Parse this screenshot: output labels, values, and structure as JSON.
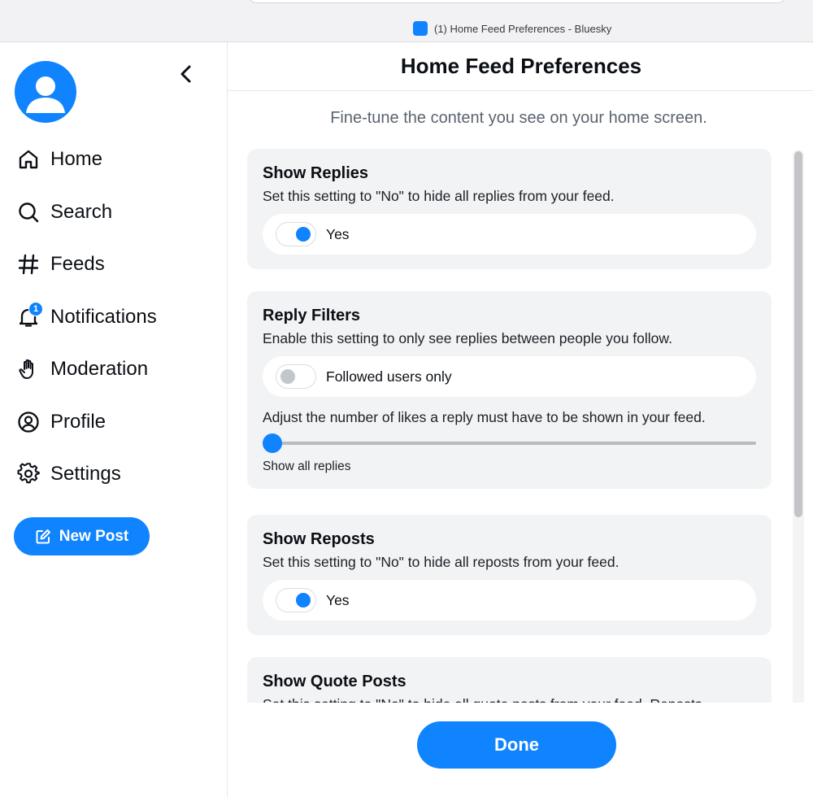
{
  "browser": {
    "tab_title": "(1) Home Feed Preferences - Bluesky"
  },
  "sidebar": {
    "avatar_icon": "user-avatar",
    "back_icon": "chevron-left-icon",
    "items": [
      {
        "label": "Home",
        "icon": "home-icon"
      },
      {
        "label": "Search",
        "icon": "search-icon"
      },
      {
        "label": "Feeds",
        "icon": "hash-icon"
      },
      {
        "label": "Notifications",
        "icon": "bell-icon",
        "badge": "1"
      },
      {
        "label": "Moderation",
        "icon": "hand-icon"
      },
      {
        "label": "Profile",
        "icon": "user-circle-icon"
      },
      {
        "label": "Settings",
        "icon": "gear-icon"
      }
    ],
    "new_post_label": "New Post"
  },
  "main": {
    "title": "Home Feed Preferences",
    "subtitle": "Fine-tune the content you see on your home screen.",
    "sections": {
      "replies": {
        "title": "Show Replies",
        "description": "Set this setting to \"No\" to hide all replies from your feed.",
        "toggle_label": "Yes",
        "toggle_on": true
      },
      "reply_filters": {
        "title": "Reply Filters",
        "description": "Enable this setting to only see replies between people you follow.",
        "toggle_label": "Followed users only",
        "toggle_on": false,
        "slider_description": "Adjust the number of likes a reply must have to be shown in your feed.",
        "slider_value": 0,
        "slider_value_label": "Show all replies"
      },
      "reposts": {
        "title": "Show Reposts",
        "description": "Set this setting to \"No\" to hide all reposts from your feed.",
        "toggle_label": "Yes",
        "toggle_on": true
      },
      "quote_posts": {
        "title": "Show Quote Posts",
        "description": "Set this setting to \"No\" to hide all quote posts from your feed. Reposts"
      }
    },
    "done_label": "Done"
  },
  "colors": {
    "accent": "#1083fe",
    "card_bg": "#f1f3f5",
    "muted_text": "#5b6470"
  }
}
